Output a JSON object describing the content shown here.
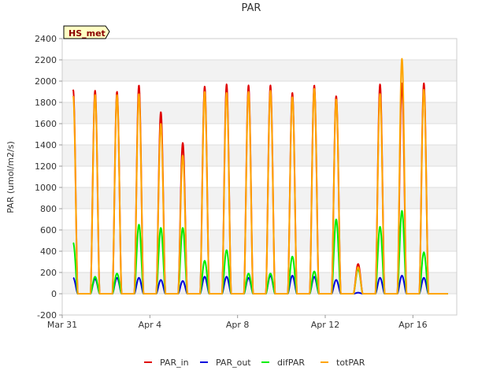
{
  "chart_data": {
    "type": "line",
    "title": "PAR",
    "ylabel": "PAR (umol/m2/s)",
    "xlabel": "",
    "badge": "HS_met",
    "ylim": [
      -200,
      2400
    ],
    "yticks": [
      -200,
      0,
      200,
      400,
      600,
      800,
      1000,
      1200,
      1400,
      1600,
      1800,
      2000,
      2200,
      2400
    ],
    "x_ticks": [
      {
        "label": "Mar 31",
        "day": 0
      },
      {
        "label": "Apr 4",
        "day": 4
      },
      {
        "label": "Apr 8",
        "day": 8
      },
      {
        "label": "Apr 12",
        "day": 12
      },
      {
        "label": "Apr 16",
        "day": 16
      }
    ],
    "xlim_days": [
      0,
      18
    ],
    "grid": true,
    "legend_position": "bottom",
    "daily_peaks": {
      "days": [
        "Mar 31",
        "Apr 1",
        "Apr 2",
        "Apr 3",
        "Apr 4",
        "Apr 5",
        "Apr 6",
        "Apr 7",
        "Apr 8",
        "Apr 9",
        "Apr 10",
        "Apr 11",
        "Apr 12",
        "Apr 13",
        "Apr 14",
        "Apr 15",
        "Apr 16",
        "Apr 17"
      ],
      "PAR_in": [
        1920,
        1910,
        1900,
        1960,
        1710,
        1420,
        1950,
        1970,
        1960,
        1960,
        1890,
        1960,
        1860,
        280,
        1970,
        1980,
        1980,
        0
      ],
      "PAR_out": [
        150,
        140,
        150,
        150,
        130,
        120,
        160,
        160,
        150,
        170,
        170,
        160,
        130,
        10,
        150,
        170,
        150,
        0
      ],
      "difPAR": [
        480,
        160,
        190,
        650,
        620,
        620,
        310,
        410,
        190,
        190,
        350,
        210,
        700,
        230,
        630,
        780,
        390,
        0
      ],
      "totPAR": [
        1860,
        1870,
        1870,
        1880,
        1600,
        1300,
        1900,
        1890,
        1900,
        1910,
        1850,
        1930,
        1830,
        250,
        1880,
        2210,
        1920,
        0
      ]
    },
    "series": [
      {
        "name": "PAR_in",
        "color": "#e00000"
      },
      {
        "name": "PAR_out",
        "color": "#0000dd"
      },
      {
        "name": "difPAR",
        "color": "#00ee00"
      },
      {
        "name": "totPAR",
        "color": "#ffa500"
      }
    ]
  }
}
